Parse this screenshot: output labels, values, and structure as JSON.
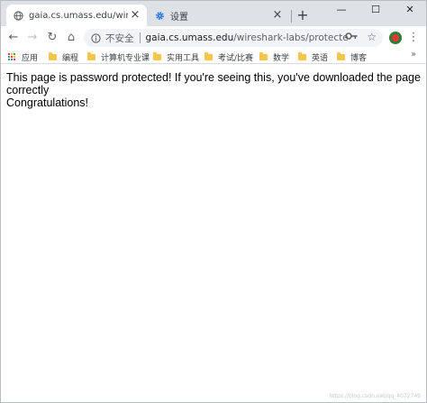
{
  "tabs": [
    {
      "title": "gaia.cs.umass.edu/wireshark-l",
      "icon": "globe-icon",
      "active": true
    },
    {
      "title": "设置",
      "icon": "gear-icon",
      "active": false
    }
  ],
  "window_controls": {
    "minimize": "—",
    "maximize": "☐",
    "close": "✕"
  },
  "toolbar": {
    "back": "←",
    "forward": "→",
    "reload": "↻",
    "home": "⌂",
    "security_label": "不安全",
    "url_host": "gaia.cs.umass.edu",
    "url_path": "/wireshark-labs/protected_pag...",
    "menu": "⋮"
  },
  "bookmarks": [
    {
      "label": "应用",
      "icon": "apps-icon"
    },
    {
      "label": "编程",
      "icon": "folder-icon"
    },
    {
      "label": "计算机专业课",
      "icon": "folder-icon"
    },
    {
      "label": "实用工具",
      "icon": "folder-icon"
    },
    {
      "label": "考试/比赛",
      "icon": "folder-icon"
    },
    {
      "label": "数学",
      "icon": "folder-icon"
    },
    {
      "label": "英语",
      "icon": "folder-icon"
    },
    {
      "label": "博客",
      "icon": "folder-icon"
    }
  ],
  "bookmarks_more": "»",
  "page": {
    "line1": "This page is password protected! If you're seeing this, you've downloaded the page correctly",
    "line2": "Congratulations!"
  },
  "watermark": "https://blog.csdn.net/qq_4072749",
  "colors": {
    "tabstrip": "#dee1e6",
    "omnibox": "#f1f3f4",
    "folder": "#f6c54d",
    "icon_blue": "#1a73e8"
  }
}
